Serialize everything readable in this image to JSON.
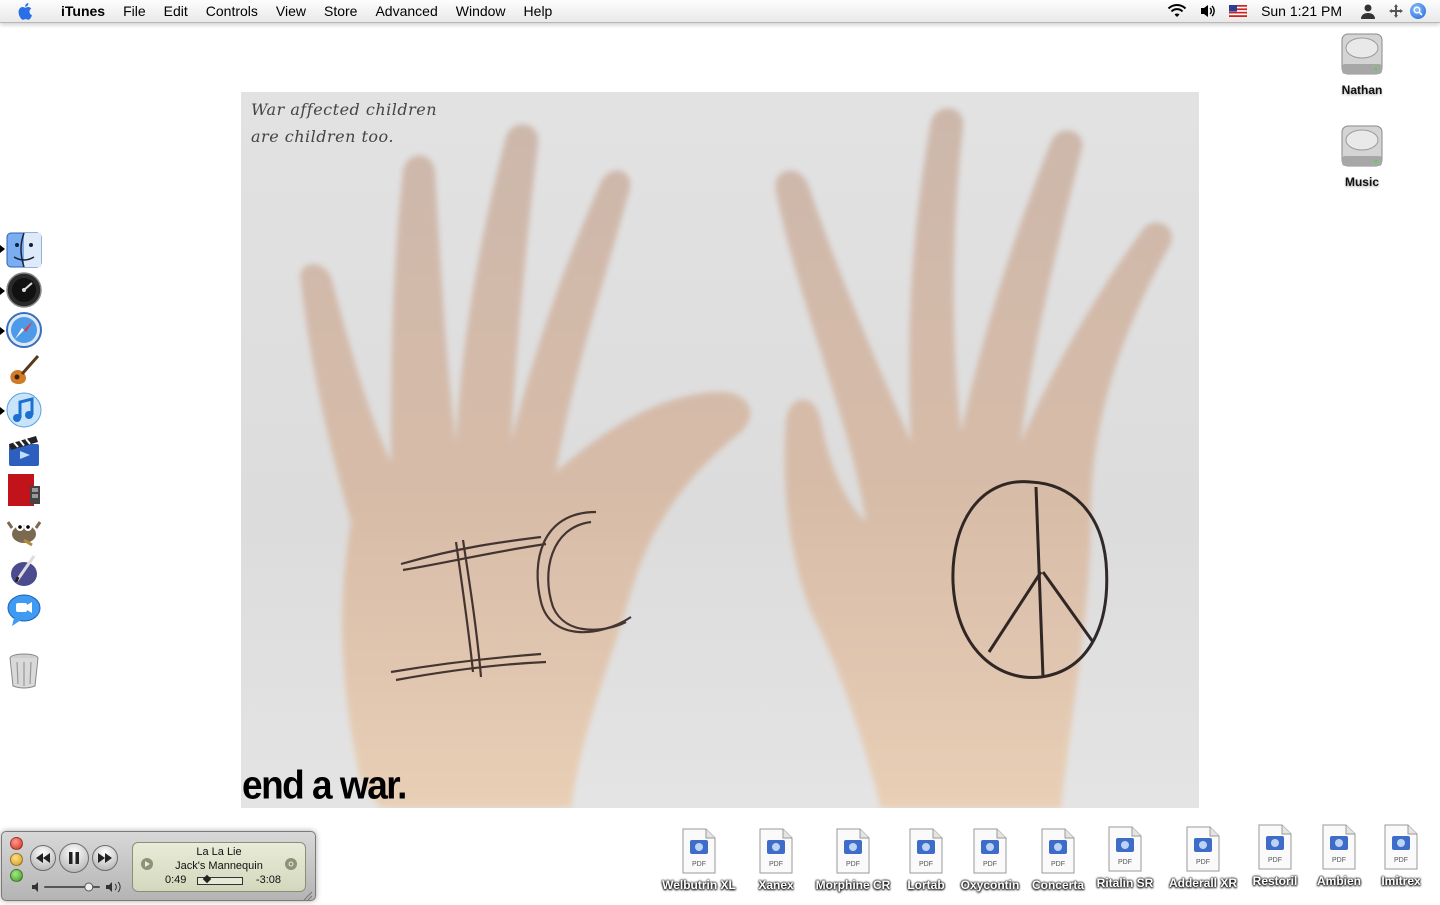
{
  "menubar": {
    "apple_icon": "apple-icon",
    "app_name": "iTunes",
    "items": [
      "File",
      "Edit",
      "Controls",
      "View",
      "Store",
      "Advanced",
      "Window",
      "Help"
    ],
    "tray_icons": [
      "wifi-icon",
      "volume-icon",
      "us-flag-icon"
    ],
    "clock": "Sun 1:21 PM",
    "right_icons": [
      "user-icon",
      "spaces-icon",
      "spotlight-icon"
    ]
  },
  "wallpaper": {
    "caption_line1": "War affected children",
    "caption_line2": "are children too.",
    "slogan": "end a war."
  },
  "dock": {
    "items": [
      {
        "name": "finder",
        "icon": "finder-icon",
        "running": true
      },
      {
        "name": "dashboard",
        "icon": "dashboard-icon",
        "running": true
      },
      {
        "name": "safari",
        "icon": "safari-icon",
        "running": true
      },
      {
        "name": "garageband",
        "icon": "garageband-icon",
        "running": false
      },
      {
        "name": "itunes",
        "icon": "itunes-icon",
        "running": true
      },
      {
        "name": "imovie",
        "icon": "imovie-icon",
        "running": false
      },
      {
        "name": "dvd-player",
        "icon": "dvd-player-icon",
        "running": false
      },
      {
        "name": "gimp",
        "icon": "gimp-icon",
        "running": false
      },
      {
        "name": "ical-pen",
        "icon": "pen-tool-icon",
        "running": false
      },
      {
        "name": "ichat",
        "icon": "ichat-icon",
        "running": false
      },
      {
        "name": "trash",
        "icon": "trash-icon",
        "running": false
      }
    ]
  },
  "desktop": {
    "drives": [
      {
        "label": "Nathan",
        "icon": "hard-drive-icon"
      },
      {
        "label": "Music",
        "icon": "hard-drive-icon"
      }
    ],
    "pdfs": [
      {
        "label": "Welbutrin XL",
        "icon": "pdf-file-icon"
      },
      {
        "label": "Xanex",
        "icon": "pdf-file-icon"
      },
      {
        "label": "Morphine CR",
        "icon": "pdf-file-icon"
      },
      {
        "label": "Lortab",
        "icon": "pdf-file-icon"
      },
      {
        "label": "Oxycontin",
        "icon": "pdf-file-icon"
      },
      {
        "label": "Concerta",
        "icon": "pdf-file-icon"
      },
      {
        "label": "Ritalin SR",
        "icon": "pdf-file-icon"
      },
      {
        "label": "Adderall XR",
        "icon": "pdf-file-icon"
      },
      {
        "label": "Restoril",
        "icon": "pdf-file-icon"
      },
      {
        "label": "Ambien",
        "icon": "pdf-file-icon"
      },
      {
        "label": "Imitrex",
        "icon": "pdf-file-icon"
      }
    ],
    "pdf_badge": "PDF"
  },
  "mini_player": {
    "song": "La La Lie",
    "artist": "Jack's Mannequin",
    "elapsed": "0:49",
    "remaining": "-3:08",
    "progress_fraction": 0.21,
    "volume_fraction": 0.8,
    "state": "playing"
  },
  "colors": {
    "accent_blue": "#1a5fd6",
    "close_red": "#d52d1c",
    "minimize_yellow": "#d49a12",
    "zoom_green": "#3b9a1b"
  }
}
